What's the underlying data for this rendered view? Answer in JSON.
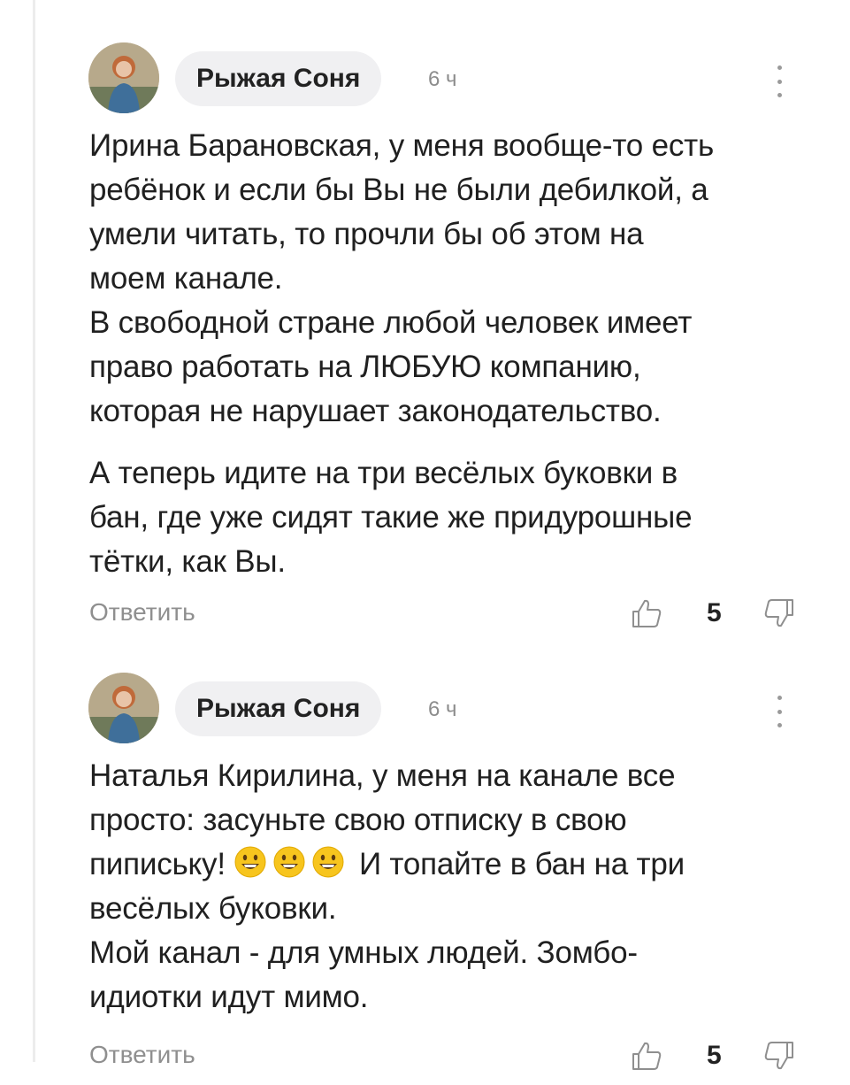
{
  "comments": [
    {
      "author": "Рыжая Соня",
      "time": "6 ч",
      "paragraphs": [
        [
          "Ирина Барановская, у меня вообще-то есть",
          "ребёнок и если бы Вы не были дебилкой, а",
          "умели читать, то прочли бы об этом на",
          "моем канале.",
          "В свободной стране любой человек имеет",
          "право работать на ЛЮБУЮ компанию,",
          "которая не нарушает законодательство."
        ],
        [
          "А теперь идите на три весёлых буковки в",
          "бан, где уже сидят такие же придурошные",
          "тётки, как Вы."
        ]
      ],
      "reply_label": "Ответить",
      "likes": "5"
    },
    {
      "author": "Рыжая Соня",
      "time": "6 ч",
      "lines": {
        "l1": "Наталья Кирилина, у меня на канале все",
        "l2": "просто: засуньте свою отписку в свою",
        "l3_before": "пипиську! ",
        "l3_after": " И топайте в бан на три",
        "l4": "весёлых буковки.",
        "l5": "Мой канал - для умных людей. Зомбо-",
        "l6": "идиотки идут мимо."
      },
      "emojis": [
        "grinning-face-icon",
        "grinning-face-icon",
        "grinning-face-icon"
      ],
      "reply_label": "Ответить",
      "likes": "5"
    }
  ],
  "colors": {
    "text": "#202020",
    "muted": "#8f8f8f",
    "pill": "#f0f0f2",
    "emoji": "#f7c51e"
  }
}
